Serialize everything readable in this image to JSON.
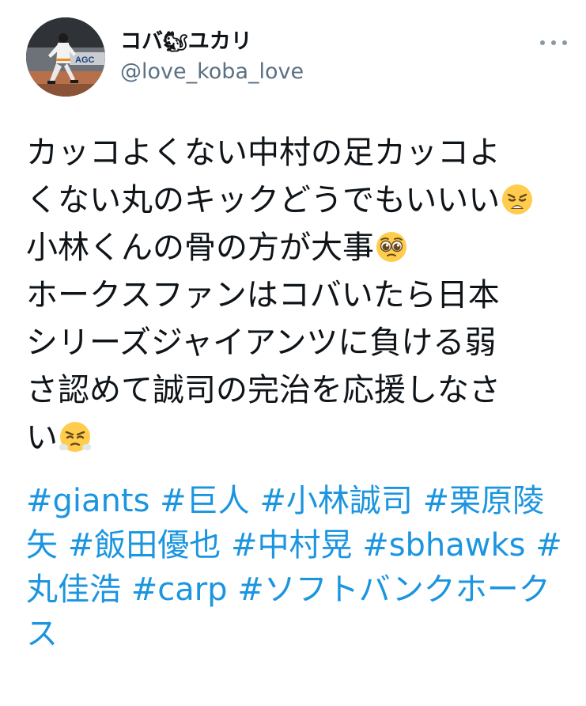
{
  "user": {
    "display_name_prefix": "コバ",
    "display_name_emoji": "🐿",
    "display_name_suffix": "ユカリ",
    "handle": "@love_koba_love",
    "avatar_icon": "baseball-player-photo",
    "avatar_sign": "AGC"
  },
  "menu": {
    "icon": "more-dots-icon"
  },
  "tweet": {
    "lines": [
      "カッコよくない中村の足カッコよ",
      "くない丸のキックどうでもいいい",
      "小林くんの骨の方が大事",
      "ホークスファンはコバいたら日本",
      "シリーズジャイアンツに負ける弱",
      "さ認めて誠司の完治を応援しなさ",
      "い"
    ],
    "emoji": {
      "weary": "weary-face-emoji",
      "pleading": "pleading-face-emoji",
      "steam": "face-with-steam-emoji"
    }
  },
  "hashtags": {
    "tag1": "#giants",
    "tag2": "#巨人",
    "tag3": "#小林誠司",
    "tag4a": "#栗原陵",
    "tag4b": "矢",
    "tag5": "#飯田優也",
    "tag6": "#中村晃",
    "tag7": "#sbhawks",
    "tag8a": "#",
    "tag8b": "丸佳浩",
    "tag9": "#carp",
    "tag10a": "#ソフトバンクホーク",
    "tag10b": "ス"
  },
  "colors": {
    "link": "#1b95e0",
    "text": "#0f1419",
    "secondary": "#5b7083"
  }
}
